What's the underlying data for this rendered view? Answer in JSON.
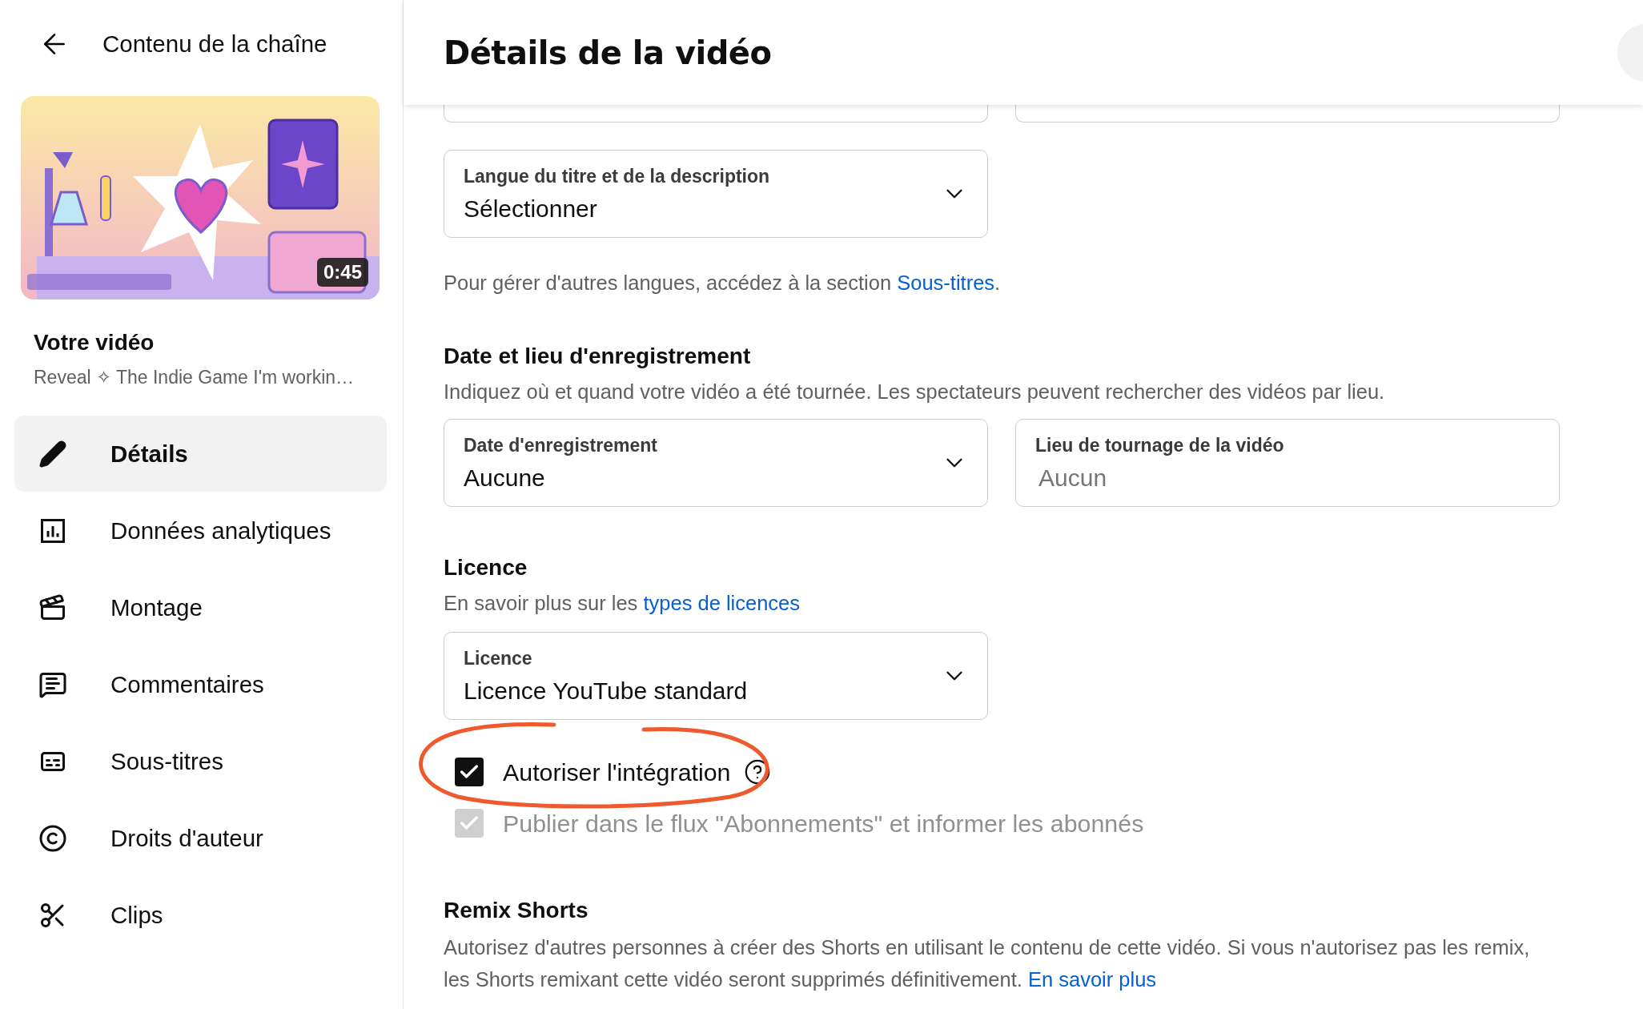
{
  "sidebar": {
    "back_title": "Contenu de la chaîne",
    "video": {
      "duration": "0:45",
      "heading": "Votre vidéo",
      "title": "Reveal ✧ The Indie Game I'm workin…"
    },
    "nav": [
      {
        "label": "Détails",
        "kind": "pencil",
        "selected": true
      },
      {
        "label": "Données analytiques",
        "kind": "analytics",
        "selected": false
      },
      {
        "label": "Montage",
        "kind": "film",
        "selected": false
      },
      {
        "label": "Commentaires",
        "kind": "comment",
        "selected": false
      },
      {
        "label": "Sous-titres",
        "kind": "subtitles",
        "selected": false
      },
      {
        "label": "Droits d'auteur",
        "kind": "copyright",
        "selected": false
      },
      {
        "label": "Clips",
        "kind": "scissors",
        "selected": false
      }
    ]
  },
  "main": {
    "title": "Détails de la vidéo",
    "language_field": {
      "label": "Langue du titre et de la description",
      "value": "Sélectionner"
    },
    "language_note": {
      "text": "Pour gérer d'autres langues, accédez à la section ",
      "link": "Sous-titres",
      "after": "."
    },
    "recording": {
      "heading": "Date et lieu d'enregistrement",
      "description": "Indiquez où et quand votre vidéo a été tournée. Les spectateurs peuvent rechercher des vidéos par lieu.",
      "date_field": {
        "label": "Date d'enregistrement",
        "value": "Aucune"
      },
      "location_field": {
        "label": "Lieu de tournage de la vidéo",
        "placeholder": "Aucun"
      }
    },
    "licence": {
      "heading": "Licence",
      "note": "En savoir plus sur les ",
      "link": "types de licences",
      "field": {
        "label": "Licence",
        "value": "Licence YouTube standard"
      }
    },
    "checkboxes": [
      {
        "label": "Autoriser l'intégration",
        "checked": true,
        "disabled": false,
        "help": true,
        "highlighted": true
      },
      {
        "label": "Publier dans le flux \"Abonnements\" et informer les abonnés",
        "checked": true,
        "disabled": true,
        "help": false,
        "highlighted": false
      }
    ],
    "remix": {
      "heading": "Remix Shorts",
      "text": "Autorisez d'autres personnes à créer des Shorts en utilisant le contenu de cette vidéo. Si vous n'autorisez pas les remix, les Shorts remixant cette vidéo seront supprimés définitivement. ",
      "link": "En savoir plus"
    }
  }
}
